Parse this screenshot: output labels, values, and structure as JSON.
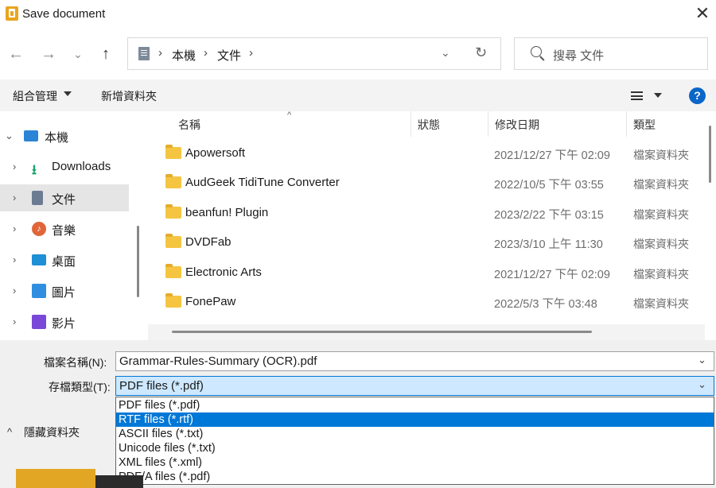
{
  "window": {
    "title": "Save document",
    "close_glyph": "✕"
  },
  "nav": {
    "back_glyph": "←",
    "forward_glyph": "→",
    "recent_glyph": "⌄",
    "up_glyph": "↑",
    "breadcrumb": [
      "本機",
      "文件"
    ],
    "separator": "›",
    "dropdown_glyph": "⌄",
    "refresh_glyph": "↻"
  },
  "search": {
    "placeholder": "搜尋 文件"
  },
  "toolbar": {
    "organize_label": "組合管理",
    "new_folder_label": "新增資料夾",
    "help_glyph": "?"
  },
  "sidebar": {
    "items": [
      {
        "label": "本機",
        "icon": "computer-icon",
        "expanded": true,
        "color": "#2c84d6"
      },
      {
        "label": "Downloads",
        "icon": "download-icon",
        "color": "#1ca46f"
      },
      {
        "label": "文件",
        "icon": "documents-icon",
        "selected": true,
        "color": "#6b7c92"
      },
      {
        "label": "音樂",
        "icon": "music-icon",
        "color": "#e0663a"
      },
      {
        "label": "桌面",
        "icon": "desktop-icon",
        "color": "#1f8fd6"
      },
      {
        "label": "圖片",
        "icon": "pictures-icon",
        "color": "#2f8ee0"
      },
      {
        "label": "影片",
        "icon": "videos-icon",
        "color": "#7a48d8"
      }
    ]
  },
  "filelist": {
    "columns": [
      "名稱",
      "狀態",
      "修改日期",
      "類型"
    ],
    "sort_glyph": "^",
    "rows": [
      {
        "name": "Apowersoft",
        "date": "2021/12/27 下午 02:09",
        "type": "檔案資料夾"
      },
      {
        "name": "AudGeek TidiTune Converter",
        "date": "2022/10/5 下午 03:55",
        "type": "檔案資料夾"
      },
      {
        "name": "beanfun! Plugin",
        "date": "2023/2/22 下午 03:15",
        "type": "檔案資料夾"
      },
      {
        "name": "DVDFab",
        "date": "2023/3/10 上午 11:30",
        "type": "檔案資料夾"
      },
      {
        "name": "Electronic Arts",
        "date": "2021/12/27 下午 02:09",
        "type": "檔案資料夾"
      },
      {
        "name": "FonePaw",
        "date": "2022/5/3 下午 03:48",
        "type": "檔案資料夾"
      }
    ]
  },
  "form": {
    "filename_label": "檔案名稱(N):",
    "filename_value": "Grammar-Rules-Summary (OCR).pdf",
    "filetype_label": "存檔類型(T):",
    "filetype_value": "PDF files (*.pdf)",
    "caret_glyph": "⌄",
    "options": [
      "PDF files (*.pdf)",
      "RTF files (*.rtf)",
      "ASCII files (*.txt)",
      "Unicode files (*.txt)",
      "XML files (*.xml)",
      "PDF/A files (*.pdf)"
    ],
    "highlighted_option_index": 1
  },
  "footer": {
    "hide_folders_label": "隱藏資料夾",
    "hide_caret_glyph": "^"
  },
  "colors": {
    "accent": "#0078d7",
    "selection_bg": "#cde8ff",
    "folder": "#f5c542",
    "help": "#0a66c8"
  }
}
